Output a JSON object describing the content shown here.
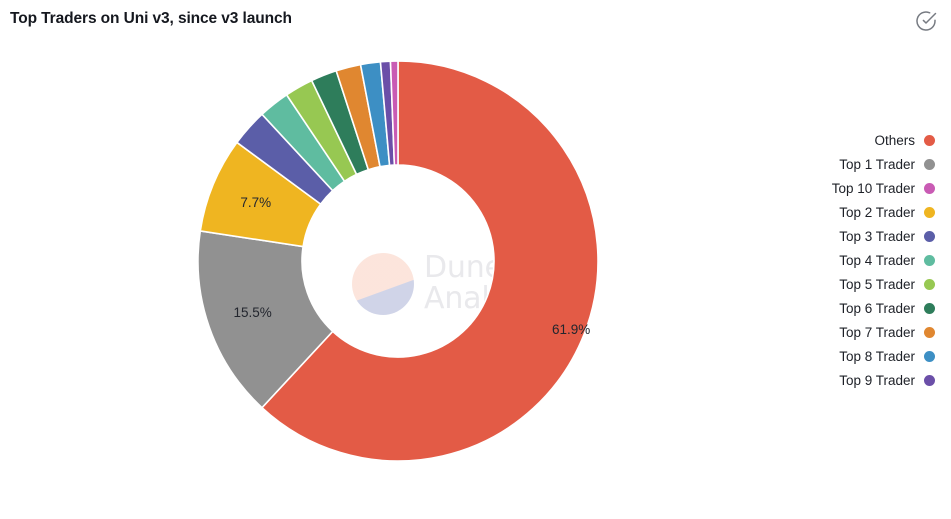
{
  "header": {
    "title": "Top Traders on Uni v3, since v3 launch",
    "action_icon": "check-circle-icon"
  },
  "watermark": {
    "line1": "Dune",
    "line2": "Analytics"
  },
  "legend": {
    "position": "right",
    "items": [
      {
        "label": "Others",
        "color": "#e35b46"
      },
      {
        "label": "Top 1 Trader",
        "color": "#919191"
      },
      {
        "label": "Top 10 Trader",
        "color": "#c95bb4"
      },
      {
        "label": "Top 2 Trader",
        "color": "#efb521"
      },
      {
        "label": "Top 3 Trader",
        "color": "#5b5ea8"
      },
      {
        "label": "Top 4 Trader",
        "color": "#5fbca0"
      },
      {
        "label": "Top 5 Trader",
        "color": "#97c852"
      },
      {
        "label": "Top 6 Trader",
        "color": "#2e7d5b"
      },
      {
        "label": "Top 7 Trader",
        "color": "#e08730"
      },
      {
        "label": "Top 8 Trader",
        "color": "#3d8fc4"
      },
      {
        "label": "Top 9 Trader",
        "color": "#6b4fa8"
      }
    ]
  },
  "chart_data": {
    "type": "pie",
    "variant": "donut",
    "title": "Top Traders on Uni v3, since v3 launch",
    "hole_ratio": 0.48,
    "start_angle_deg": 0,
    "direction": "clockwise",
    "value_unit": "percent",
    "labels_shown": [
      "61.9%",
      "15.5%",
      "7.7%"
    ],
    "categories": [
      "Others",
      "Top 1 Trader",
      "Top 2 Trader",
      "Top 3 Trader",
      "Top 4 Trader",
      "Top 5 Trader",
      "Top 6 Trader",
      "Top 7 Trader",
      "Top 8 Trader",
      "Top 9 Trader",
      "Top 10 Trader"
    ],
    "values": [
      61.9,
      15.5,
      7.7,
      3.0,
      2.5,
      2.3,
      2.1,
      2.0,
      1.6,
      0.8,
      0.6
    ],
    "colors": [
      "#e35b46",
      "#919191",
      "#efb521",
      "#5b5ea8",
      "#5fbca0",
      "#97c852",
      "#2e7d5b",
      "#e08730",
      "#3d8fc4",
      "#6b4fa8",
      "#c95bb4"
    ],
    "slice_order_clockwise": [
      "Others",
      "Top 1 Trader",
      "Top 2 Trader",
      "Top 3 Trader",
      "Top 4 Trader",
      "Top 5 Trader",
      "Top 6 Trader",
      "Top 7 Trader",
      "Top 8 Trader",
      "Top 9 Trader",
      "Top 10 Trader"
    ],
    "xlabel": "",
    "ylabel": "",
    "grid": false
  }
}
